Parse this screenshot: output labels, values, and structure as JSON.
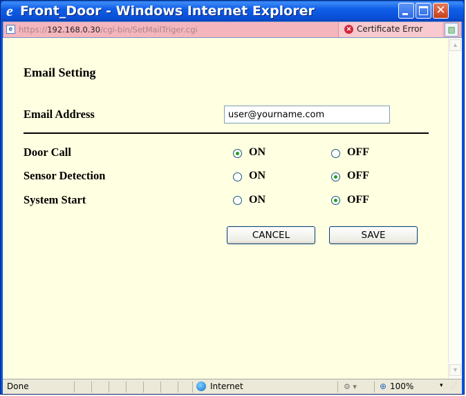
{
  "window": {
    "title": "Front_Door - Windows Internet Explorer",
    "title_icon": "e"
  },
  "address": {
    "url_scheme": "https://",
    "url_host": "192.168.0.30",
    "url_path": "/cgi-bin/SetMailTriger.cgi",
    "certificate_label": "Certificate Error"
  },
  "page": {
    "heading": "Email Setting",
    "email": {
      "label": "Email Address",
      "value": "user@yourname.com"
    },
    "settings": [
      {
        "label": "Door Call",
        "on_label": "ON",
        "off_label": "OFF",
        "selected": "ON"
      },
      {
        "label": "Sensor Detection",
        "on_label": "ON",
        "off_label": "OFF",
        "selected": "OFF"
      },
      {
        "label": "System Start",
        "on_label": "ON",
        "off_label": "OFF",
        "selected": "OFF"
      }
    ],
    "buttons": {
      "cancel": "CANCEL",
      "save": "SAVE"
    }
  },
  "status": {
    "text": "Done",
    "zone": "Internet",
    "zoom": "100%"
  },
  "colors": {
    "page_background": "#ffffe1",
    "address_bar_error": "#f5b5bd",
    "radio_checked": "#21a121",
    "titlebar": "#0a4fd6"
  }
}
